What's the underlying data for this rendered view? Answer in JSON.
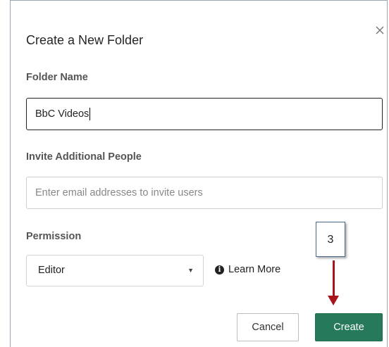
{
  "dialog": {
    "title": "Create a New Folder",
    "close_icon": "close-icon",
    "folder_name": {
      "label": "Folder Name",
      "value": "BbC Videos"
    },
    "invite": {
      "label": "Invite Additional People",
      "placeholder": "Enter email addresses to invite users"
    },
    "permission": {
      "label": "Permission",
      "selected": "Editor",
      "learn_more": "Learn More",
      "info_icon": "info-icon"
    },
    "buttons": {
      "cancel": "Cancel",
      "create": "Create"
    },
    "colors": {
      "create_button": "#26795a",
      "annotation_arrow": "#a8151b"
    }
  },
  "annotation": {
    "step_number": "3"
  }
}
